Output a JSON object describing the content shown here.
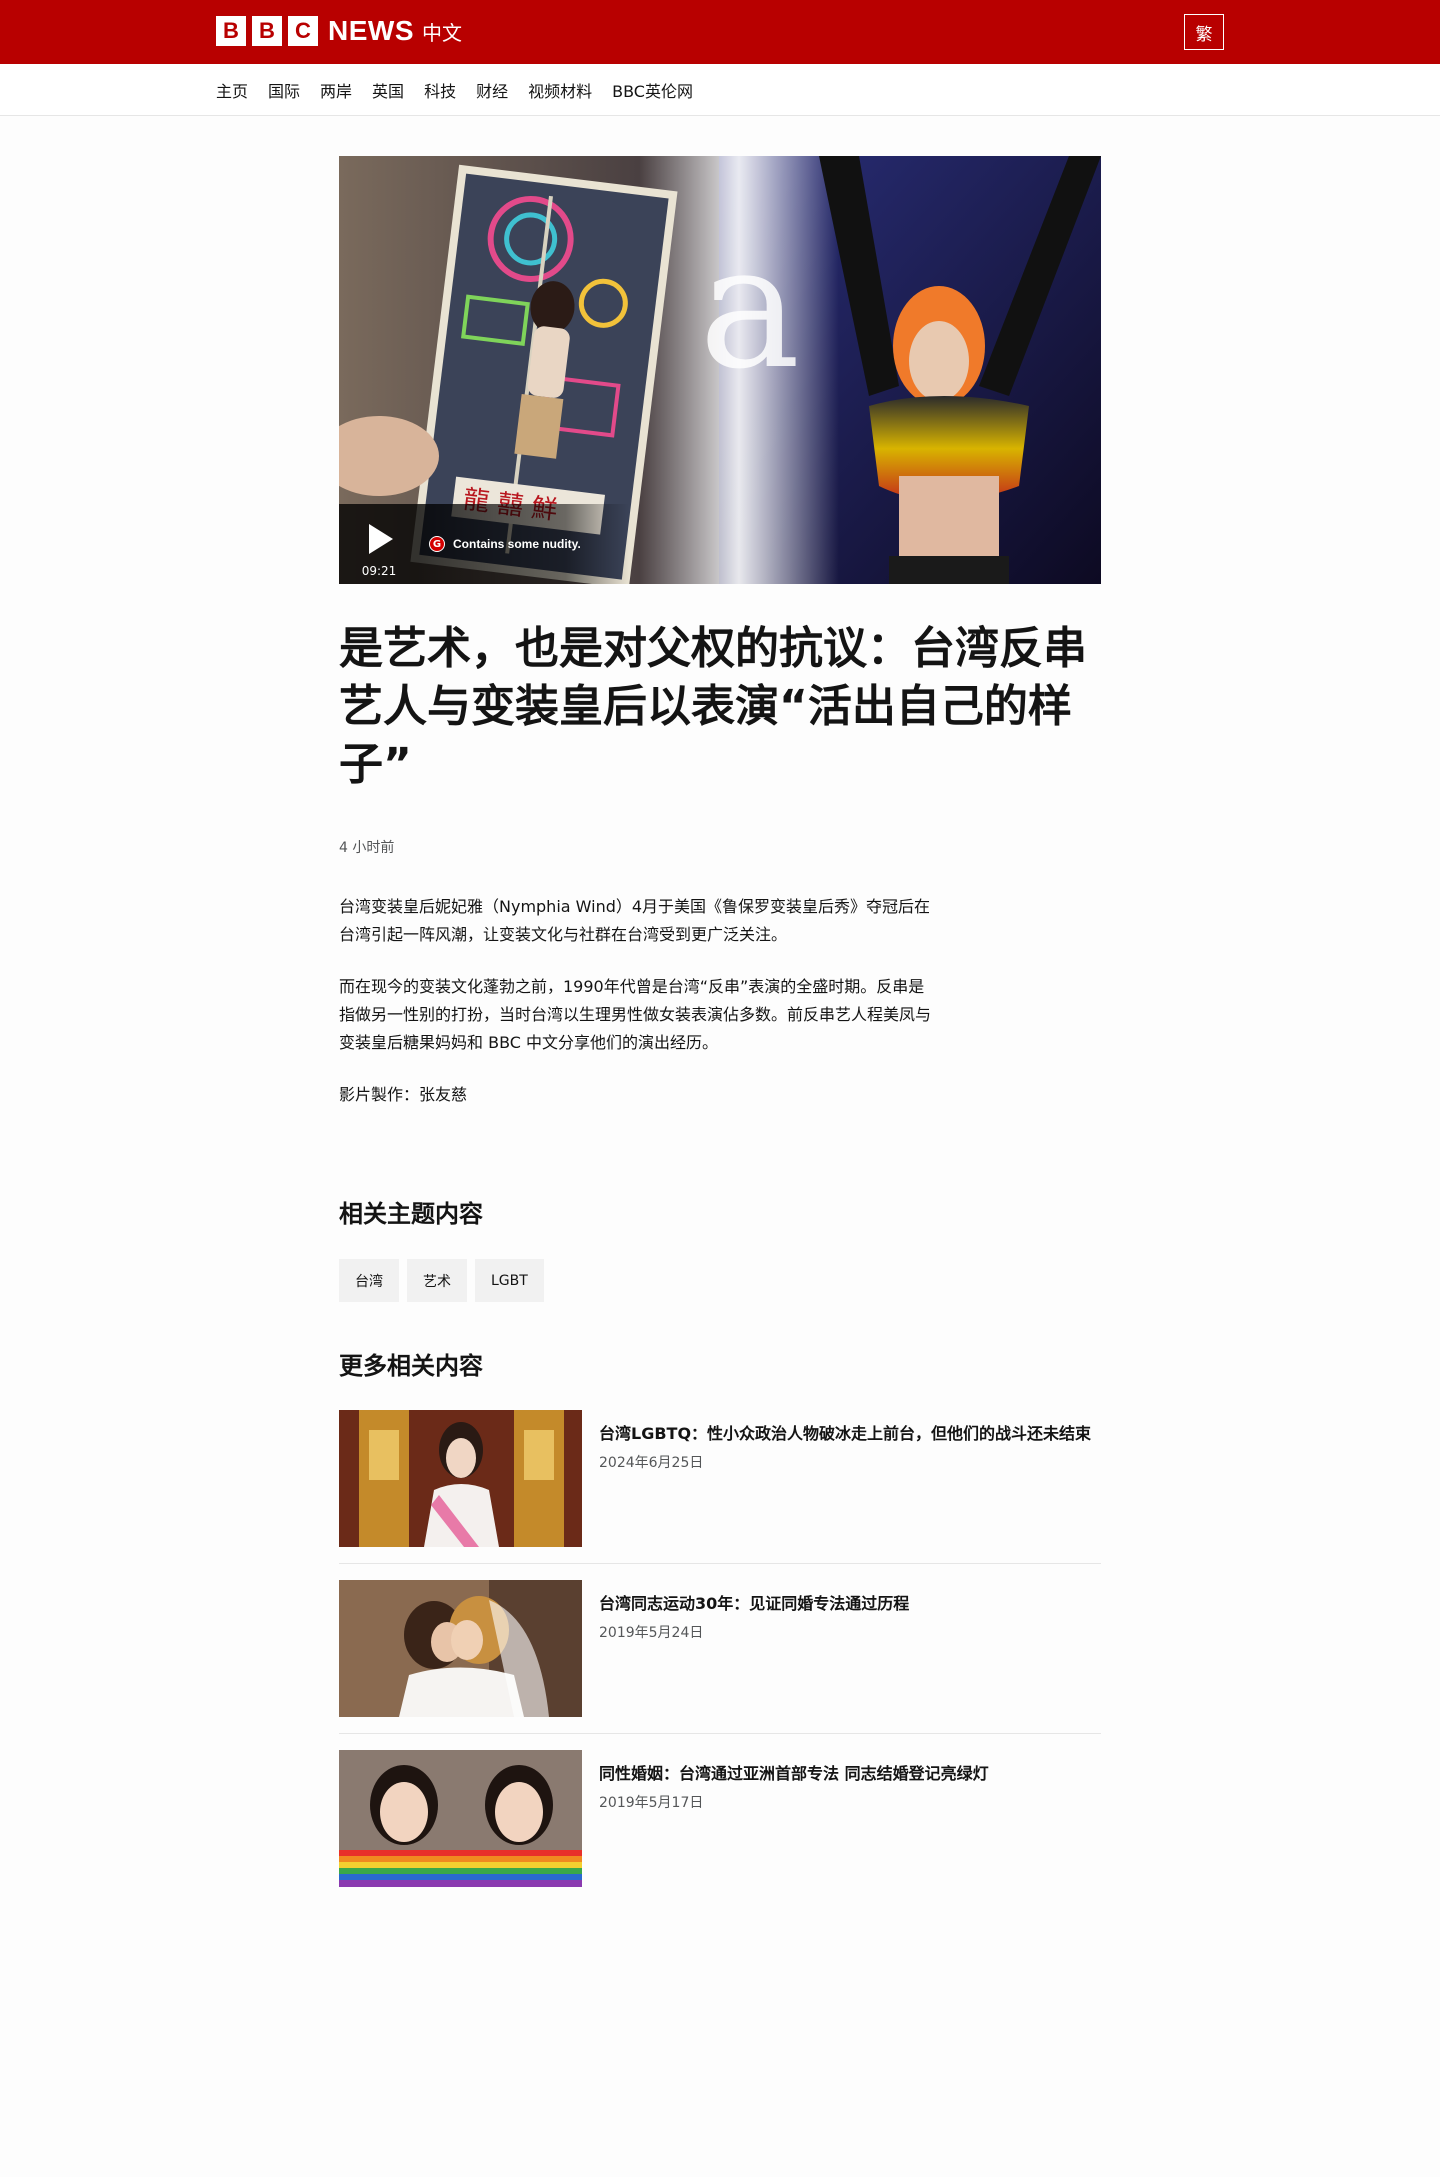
{
  "header": {
    "logo_letters": [
      "B",
      "B",
      "C"
    ],
    "logo_news": "NEWS",
    "logo_zh": "中文",
    "lang_toggle": "繁",
    "brand_color": "#b80000"
  },
  "nav": {
    "items": [
      "主页",
      "国际",
      "两岸",
      "英国",
      "科技",
      "财经",
      "视频材料",
      "BBC英伦网"
    ]
  },
  "video": {
    "duration": "09:21",
    "badge": "G",
    "warning": "Contains some nudity.",
    "play_icon": "play-icon"
  },
  "article": {
    "headline": "是艺术，也是对父权的抗议：台湾反串艺人与变装皇后以表演“活出自己的样子”",
    "timestamp": "4 小时前",
    "paragraphs": [
      "台湾变装皇后妮妃雅（Nymphia Wind）4月于美国《鲁保罗变装皇后秀》夺冠后在台湾引起一阵风潮，让变装文化与社群在台湾受到更广泛关注。",
      "而在现今的变装文化蓬勃之前，1990年代曾是台湾“反串”表演的全盛时期。反串是指做另一性别的打扮，当时台湾以生理男性做女装表演佔多数。前反串艺人程美凤与变装皇后糖果妈妈和 BBC 中文分享他们的演出经历。",
      "影片製作：张友慈"
    ]
  },
  "topics": {
    "title": "相关主题内容",
    "tags": [
      "台湾",
      "艺术",
      "LGBT"
    ]
  },
  "more": {
    "title": "更多相关内容",
    "items": [
      {
        "title": "台湾LGBTQ：性小众政治人物破冰走上前台，但他们的战斗还未结束",
        "date": "2024年6月25日"
      },
      {
        "title": "台湾同志运动30年：见证同婚专法通过历程",
        "date": "2019年5月24日"
      },
      {
        "title": "同性婚姻：台湾通过亚洲首部专法 同志结婚登记亮绿灯",
        "date": "2019年5月17日"
      }
    ]
  }
}
